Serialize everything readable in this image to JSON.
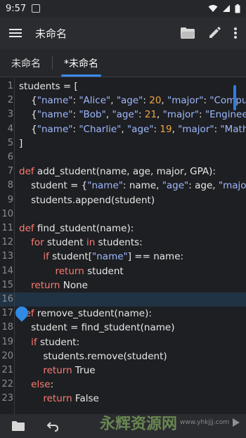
{
  "status": {
    "time": "9:57"
  },
  "app": {
    "title": "未命名"
  },
  "tabs": [
    {
      "label": "未命名",
      "active": false
    },
    {
      "label": "*未命名",
      "active": true
    }
  ],
  "code_lines": [
    {
      "n": "1",
      "html": "students = ["
    },
    {
      "n": "2",
      "html": "    {<span class='str'>\"name\"</span>: <span class='str'>\"Alice\"</span>, <span class='str'>\"age\"</span>: <span class='num'>20</span>, <span class='str'>\"major\"</span>: <span class='str'>\"Computer</span>"
    },
    {
      "n": "3",
      "html": "    {<span class='str'>\"name\"</span>: <span class='str'>\"Bob\"</span>, <span class='str'>\"age\"</span>: <span class='num'>21</span>, <span class='str'>\"major\"</span>: <span class='str'>\"Engineerin</span>"
    },
    {
      "n": "4",
      "html": "    {<span class='str'>\"name\"</span>: <span class='str'>\"Charlie\"</span>, <span class='str'>\"age\"</span>: <span class='num'>19</span>, <span class='str'>\"major\"</span>: <span class='str'>\"Mathem</span>"
    },
    {
      "n": "5",
      "html": "]"
    },
    {
      "n": "6",
      "html": ""
    },
    {
      "n": "7",
      "html": "<span class='kw'>def</span> add_student(name, age, major, GPA):"
    },
    {
      "n": "8",
      "html": "    student = {<span class='str'>\"name\"</span>: name, <span class='str'>\"age\"</span>: age, <span class='str'>\"major\"</span>:"
    },
    {
      "n": "9",
      "html": "    students.append(student)"
    },
    {
      "n": "10",
      "html": ""
    },
    {
      "n": "11",
      "html": "<span class='kw'>def</span> find_student(name):"
    },
    {
      "n": "12",
      "html": "    <span class='kw'>for</span> student <span class='kw'>in</span> students:"
    },
    {
      "n": "13",
      "html": "        <span class='kw'>if</span> student[<span class='str'>\"name\"</span>] == name:"
    },
    {
      "n": "14",
      "html": "            <span class='kw'>return</span> student"
    },
    {
      "n": "15",
      "html": "    <span class='kw'>return</span> None"
    },
    {
      "n": "16",
      "html": "",
      "current": true
    },
    {
      "n": "17",
      "html": "<span class='kw'>def</span> remove_student(name):"
    },
    {
      "n": "18",
      "html": "    student = find_student(name)"
    },
    {
      "n": "19",
      "html": "    <span class='kw'>if</span> student:"
    },
    {
      "n": "20",
      "html": "        students.remove(student)"
    },
    {
      "n": "21",
      "html": "        <span class='kw'>return</span> True"
    },
    {
      "n": "22",
      "html": "    <span class='kw'>else</span>:"
    },
    {
      "n": "23",
      "html": "        <span class='kw'>return</span> False"
    }
  ],
  "watermark": {
    "text": "永辉资源网",
    "url": "www.yhkjjj.com"
  },
  "colors": {
    "accent": "#3b8cff",
    "keyword": "#ff7b72",
    "string": "#9fb9ff",
    "number": "#f0a742"
  },
  "icons": {
    "menu": "hamburger-icon",
    "open": "folder-open-icon",
    "edit": "pencil-icon",
    "more": "more-vert-icon",
    "bottom": [
      "folder-icon",
      "undo-icon",
      "play-icon"
    ]
  }
}
